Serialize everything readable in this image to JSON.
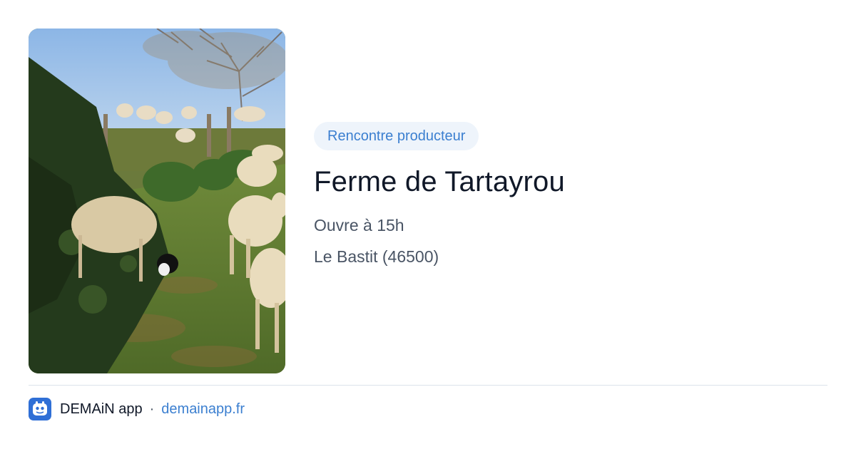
{
  "card": {
    "image": {
      "subject": "sheep-grazing-photo"
    },
    "badge": "Rencontre producteur",
    "title": "Ferme de Tartayrou",
    "hours": "Ouvre à 15h",
    "location": "Le Bastit (46500)"
  },
  "footer": {
    "app_name": "DEMAiN app",
    "separator": "·",
    "domain": "demainapp.fr"
  },
  "colors": {
    "accent": "#3b7fd0",
    "badge_bg": "#eef4fb",
    "title": "#101828",
    "meta": "#4a5565",
    "divider": "#dbe3ea",
    "app_icon_bg": "#2f6fd6"
  }
}
